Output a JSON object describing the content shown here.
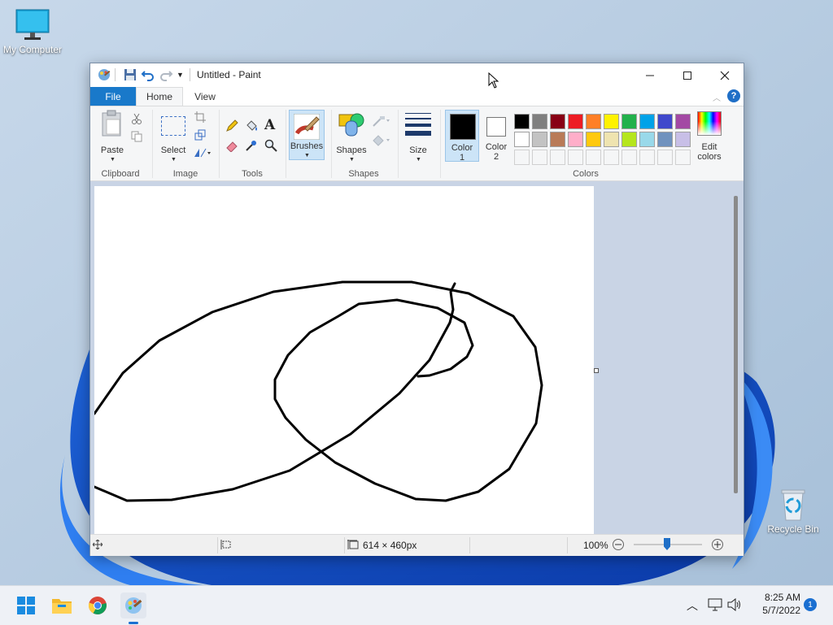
{
  "desktop": {
    "icons": [
      {
        "label": "My Computer",
        "icon": "monitor-icon"
      },
      {
        "label": "Recycle Bin",
        "icon": "recycle-bin-icon"
      }
    ]
  },
  "window": {
    "title": "Untitled - Paint",
    "tabs": {
      "file": "File",
      "home": "Home",
      "view": "View"
    },
    "ribbon": {
      "clipboard": {
        "paste": "Paste",
        "group": "Clipboard"
      },
      "image": {
        "select": "Select",
        "group": "Image"
      },
      "tools": {
        "group": "Tools"
      },
      "brushes": {
        "label": "Brushes"
      },
      "shapes": {
        "label": "Shapes",
        "group": "Shapes"
      },
      "size": {
        "label": "Size"
      },
      "color1": {
        "line1": "Color",
        "line2": "1",
        "value": "#000000"
      },
      "color2": {
        "line1": "Color",
        "line2": "2",
        "value": "#ffffff"
      },
      "colors": {
        "group": "Colors",
        "edit_line1": "Edit",
        "edit_line2": "colors",
        "palette_row1": [
          "#000000",
          "#7f7f7f",
          "#880015",
          "#ed1c24",
          "#ff7f27",
          "#fff200",
          "#22b14c",
          "#00a2e8",
          "#3f48cc",
          "#a349a4"
        ],
        "palette_row2": [
          "#ffffff",
          "#c3c3c3",
          "#b97a57",
          "#ffaec9",
          "#ffc90e",
          "#efe4b0",
          "#b5e61d",
          "#99d9ea",
          "#7092be",
          "#c8bfe7"
        ]
      }
    },
    "statusbar": {
      "dimensions": "614 × 460px",
      "zoom": "100%"
    }
  },
  "taskbar": {
    "time": "8:25 AM",
    "date": "5/7/2022",
    "notifications": "1",
    "apps": [
      "start-icon",
      "file-explorer-icon",
      "chrome-icon",
      "paint-icon"
    ]
  }
}
